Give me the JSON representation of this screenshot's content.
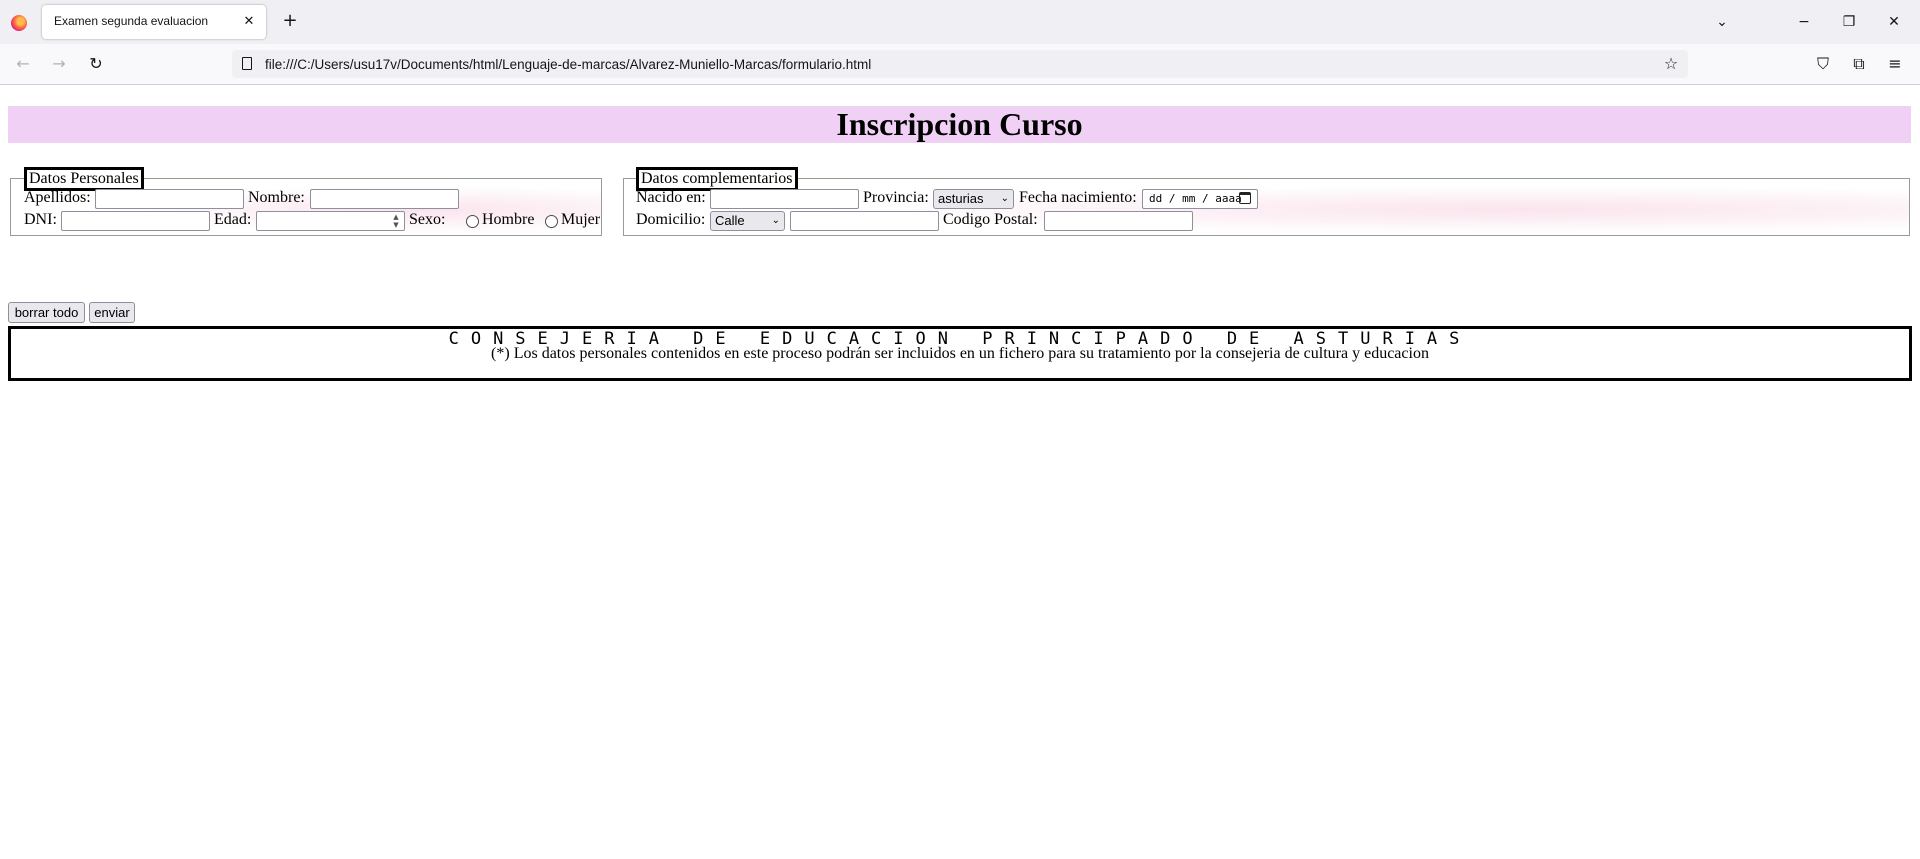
{
  "browser": {
    "tab_title": "Examen segunda evaluacion",
    "url": "file:///C:/Users/usu17v/Documents/html/Lenguaje-de-marcas/Alvarez-Muniello-Marcas/formulario.html"
  },
  "page": {
    "title": "Inscripcion Curso",
    "personal": {
      "legend": "Datos Personales",
      "apellidos_label": "Apellidos:",
      "nombre_label": "Nombre:",
      "dni_label": "DNI:",
      "edad_label": "Edad:",
      "sexo_label": "Sexo:",
      "hombre_label": "Hombre",
      "mujer_label": "Mujer",
      "apellidos_value": "",
      "nombre_value": "",
      "dni_value": "",
      "edad_value": ""
    },
    "complementarios": {
      "legend": "Datos complementarios",
      "nacido_label": "Nacido en:",
      "provincia_label": "Provincia:",
      "provincia_value": "asturias",
      "fecha_label": "Fecha nacimiento:",
      "fecha_placeholder": "dd / mm / aaaa",
      "domicilio_label": "Domicilio:",
      "domicilio_type": "Calle",
      "codigo_postal_label": "Codigo Postal:",
      "nacido_value": "",
      "domicilio_value": "",
      "codigo_postal_value": ""
    },
    "buttons": {
      "reset": "borrar todo",
      "submit": "enviar"
    },
    "notice": "(*) Los datos personales contenidos en este proceso podrán ser incluidos en un fichero para su tratamiento por la consejeria de cultura y educacion",
    "footer": "CONSEJERIA DE EDUCACION PRINCIPADO DE ASTURIAS"
  }
}
